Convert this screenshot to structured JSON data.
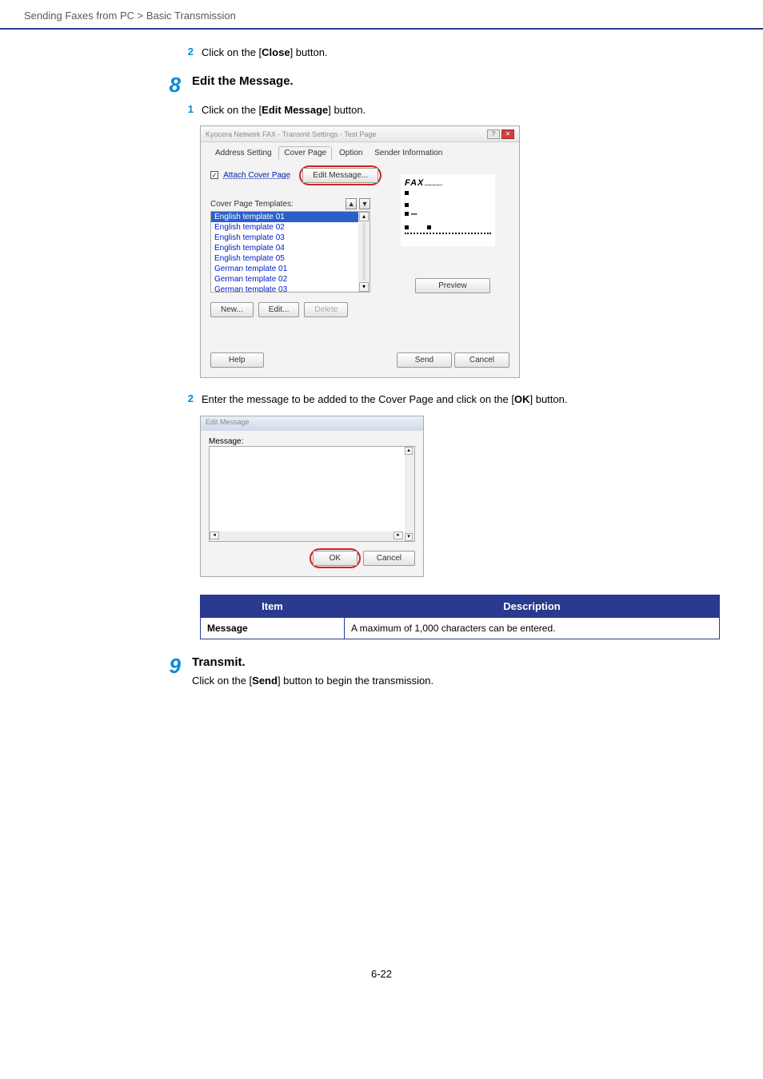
{
  "header": {
    "breadcrumb": "Sending Faxes from PC > Basic Transmission"
  },
  "s7": {
    "sub2_num": "2",
    "sub2_text_a": "Click on the [",
    "sub2_text_bold": "Close",
    "sub2_text_b": "] button."
  },
  "s8": {
    "num": "8",
    "title": "Edit the Message.",
    "sub1_num": "1",
    "sub1_a": "Click on the [",
    "sub1_bold": "Edit Message",
    "sub1_b": "] button.",
    "sub2_num": "2",
    "sub2_a": "Enter the message to be added to the Cover Page and click on the [",
    "sub2_bold": "OK",
    "sub2_b": "] button."
  },
  "dialog1": {
    "title": "Kyocera Network FAX - Transmit Settings - Test Page",
    "tabs": {
      "t1": "Address Setting",
      "t2": "Cover Page",
      "t3": "Option",
      "t4": "Sender Information"
    },
    "attach_label": "Attach Cover Page",
    "edit_msg_btn": "Edit Message...",
    "templates_label": "Cover Page Templates:",
    "templates": [
      "English template 01",
      "English template 02",
      "English template 03",
      "English template 04",
      "English template 05",
      "German template 01",
      "German template 02",
      "German template 03"
    ],
    "new_btn": "New...",
    "edit_btn": "Edit...",
    "delete_btn": "Delete",
    "preview_btn": "Preview",
    "help_btn": "Help",
    "send_btn": "Send",
    "cancel_btn": "Cancel",
    "fax_heading": "FAX"
  },
  "dialog2": {
    "title": "Edit Message",
    "msg_label": "Message:",
    "ok_btn": "OK",
    "cancel_btn": "Cancel"
  },
  "table": {
    "h_item": "Item",
    "h_desc": "Description",
    "row_item": "Message",
    "row_desc": "A maximum of 1,000 characters can be entered."
  },
  "s9": {
    "num": "9",
    "title": "Transmit.",
    "body_a": "Click on the [",
    "body_bold": "Send",
    "body_b": "] button to begin the transmission."
  },
  "page_number": "6-22"
}
